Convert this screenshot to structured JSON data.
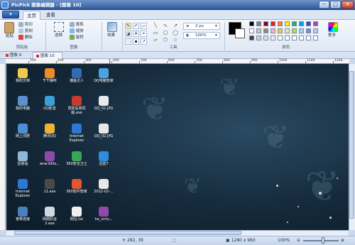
{
  "window": {
    "title": "PicPick 图像编辑器 - [图像 10]",
    "minimize": "─",
    "maximize": "□",
    "close": "✕"
  },
  "menu": {
    "app_button": "▾",
    "tabs": [
      "主页",
      "查看"
    ]
  },
  "ribbon": {
    "clipboard": {
      "group": "剪贴板",
      "paste": "粘贴",
      "cut": "剪切",
      "copy": "复制",
      "delete": "删除"
    },
    "image": {
      "group": "图像",
      "select": "选择",
      "crop": "裁剪",
      "resize": "缩放",
      "rotate": "旋转"
    },
    "effects": {
      "label": "效果"
    },
    "tools": {
      "group": "工具",
      "line_width": "2 px",
      "opacity": "100%"
    },
    "colors": {
      "group": "颜色",
      "more": "更多",
      "palette": [
        "#000000",
        "#7f7f7f",
        "#880015",
        "#ed1c24",
        "#ff7f27",
        "#fff200",
        "#22b14c",
        "#00a2e8",
        "#3f48cc",
        "#a349a4",
        "#ffffff",
        "#c3c3c3",
        "#b97a57",
        "#ffaec9",
        "#ffc90e",
        "#efe4b0",
        "#b5e61d",
        "#99d9ea",
        "#7092be",
        "#c8bfe7",
        "#404040",
        "#d0d0d0",
        "#e0e0e0",
        "#f0f0f0",
        "#ffffff",
        "#ffffff",
        "#ffffff",
        "#ffffff",
        "#ffffff",
        "#ffffff"
      ],
      "primary": "#000000",
      "secondary": "#ffffff"
    }
  },
  "doc_tabs": [
    "图像 9",
    "图像 10"
  ],
  "ruler": {
    "labels": [
      "100",
      "200",
      "300",
      "400",
      "500",
      "600",
      "700",
      "800",
      "900",
      "1000",
      "1100",
      "1200"
    ]
  },
  "desktop_icons": [
    {
      "label": "我的文档",
      "color": "#f2c94c"
    },
    {
      "label": "千千静听",
      "color": "#f08a24"
    },
    {
      "label": "捕鱼达人",
      "color": "#2f6db5"
    },
    {
      "label": "QQ电脑管家",
      "color": "#4aa3df"
    },
    {
      "label": "我的电脑",
      "color": "#5a8fd0"
    },
    {
      "label": "QQ影音",
      "color": "#39a0d8"
    },
    {
      "label": "冒险岛单机\n版.exe",
      "color": "#c63b2b"
    },
    {
      "label": "QQ_01.JPG",
      "color": "#e8e8e8"
    },
    {
      "label": "网上邻居",
      "color": "#4b8fd6"
    },
    {
      "label": "腾讯QQ",
      "color": "#f1b234"
    },
    {
      "label": "Internet\nExplorer",
      "color": "#2b79d4"
    },
    {
      "label": "QQ_02.JPG",
      "color": "#e8e8e8"
    },
    {
      "label": "回收站",
      "color": "#8fb8d8"
    },
    {
      "label": "wrar393s...",
      "color": "#8d4aa8"
    },
    {
      "label": "360安全卫士",
      "color": "#3aa655"
    },
    {
      "label": "迅雷7",
      "color": "#2e8de0"
    },
    {
      "label": "Internet\nExplorer",
      "color": "#2b79d4"
    },
    {
      "label": "11.exe",
      "color": "#4a4a4a"
    },
    {
      "label": "360软件管家",
      "color": "#e2572f"
    },
    {
      "label": "2012-02-...",
      "color": "#e8e8e8"
    },
    {
      "label": "宽带连接",
      "color": "#4a7fc1"
    },
    {
      "label": "网络防证\n3.exe",
      "color": "#cfd8e2"
    },
    {
      "label": "网址.txt",
      "color": "#f0f0f0"
    },
    {
      "label": "ha_virtu...",
      "color": "#8d4aa8"
    }
  ],
  "status": {
    "cursor": "282, 39",
    "size": "1280 x 960",
    "zoom": "100%",
    "zoom_fraction": 0.55
  }
}
